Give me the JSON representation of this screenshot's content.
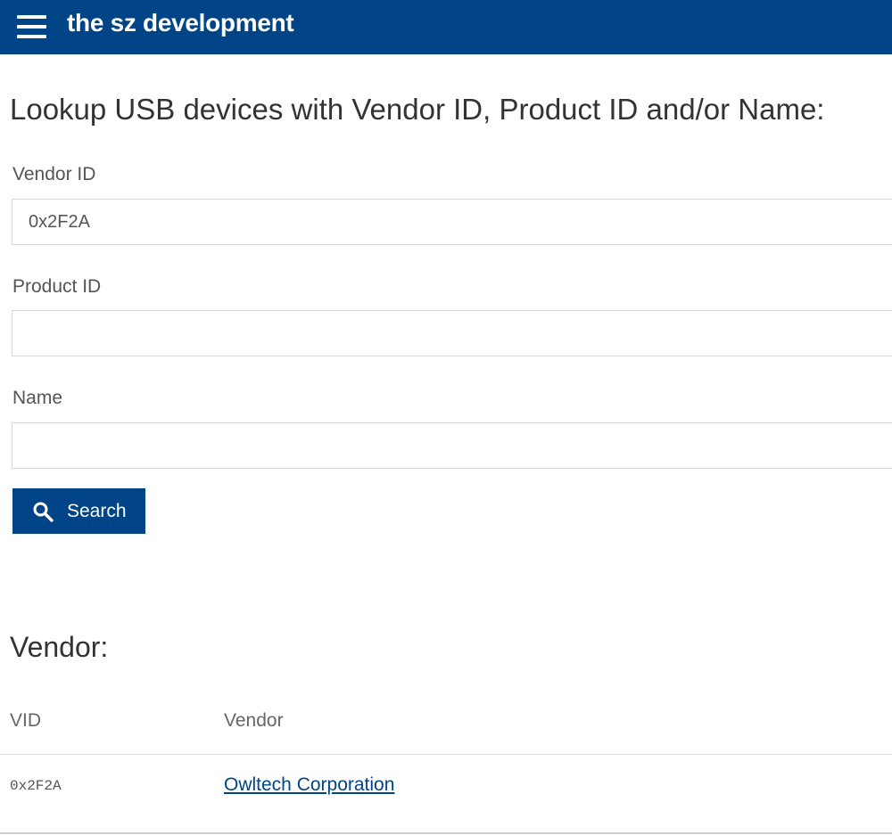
{
  "header": {
    "brand": "the sz development",
    "menu_icon": "hamburger-menu-icon",
    "background": "#004488"
  },
  "form": {
    "title": "Lookup USB devices with Vendor ID, Product ID and/or Name:",
    "vendor_id": {
      "label": "Vendor ID",
      "value": "0x2F2A"
    },
    "product_id": {
      "label": "Product ID",
      "value": ""
    },
    "name": {
      "label": "Name",
      "value": ""
    },
    "search_button": {
      "label": "Search",
      "icon": "search-icon"
    }
  },
  "results": {
    "section_title": "Vendor:",
    "columns": [
      "VID",
      "Vendor"
    ],
    "rows": [
      {
        "vid": "0x2F2A",
        "vendor": "Owltech Corporation"
      }
    ]
  }
}
